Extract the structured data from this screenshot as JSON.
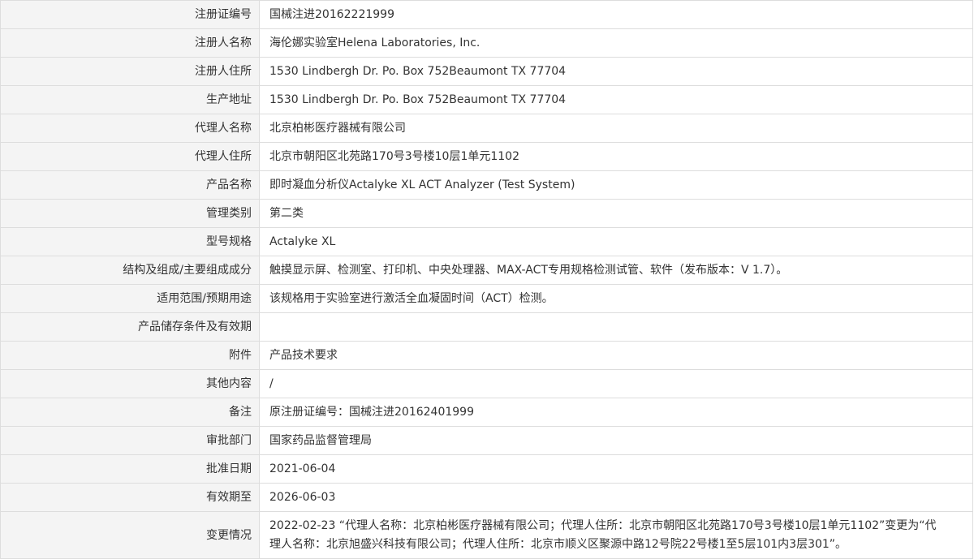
{
  "rows": [
    {
      "label": "注册证编号",
      "value": "国械注进20162221999"
    },
    {
      "label": "注册人名称",
      "value": "海伦娜实验室Helena Laboratories, Inc."
    },
    {
      "label": "注册人住所",
      "value": "1530 Lindbergh Dr. Po. Box 752Beaumont TX 77704"
    },
    {
      "label": "生产地址",
      "value": "1530 Lindbergh Dr. Po. Box 752Beaumont TX 77704"
    },
    {
      "label": "代理人名称",
      "value": "北京柏彬医疗器械有限公司"
    },
    {
      "label": "代理人住所",
      "value": "北京市朝阳区北苑路170号3号楼10层1单元1102"
    },
    {
      "label": "产品名称",
      "value": "即时凝血分析仪Actalyke XL ACT Analyzer (Test System)"
    },
    {
      "label": "管理类别",
      "value": "第二类"
    },
    {
      "label": "型号规格",
      "value": "Actalyke XL"
    },
    {
      "label": "结构及组成/主要组成成分",
      "value": "触摸显示屏、检测室、打印机、中央处理器、MAX-ACT专用规格检测试管、软件（发布版本：V 1.7）。"
    },
    {
      "label": "适用范围/预期用途",
      "value": "该规格用于实验室进行激活全血凝固时间（ACT）检测。"
    },
    {
      "label": "产品储存条件及有效期",
      "value": ""
    },
    {
      "label": "附件",
      "value": "产品技术要求"
    },
    {
      "label": "其他内容",
      "value": "/"
    },
    {
      "label": "备注",
      "value": "原注册证编号：国械注进20162401999"
    },
    {
      "label": "审批部门",
      "value": "国家药品监督管理局"
    },
    {
      "label": "批准日期",
      "value": "2021-06-04"
    },
    {
      "label": "有效期至",
      "value": "2026-06-03"
    },
    {
      "label": "变更情况",
      "value": "2022-02-23 “代理人名称：北京柏彬医疗器械有限公司；代理人住所：北京市朝阳区北苑路170号3号楼10层1单元1102”变更为“代理人名称：北京旭盛兴科技有限公司；代理人住所：北京市顺义区聚源中路12号院22号楼1至5层101内3层301”。"
    }
  ]
}
